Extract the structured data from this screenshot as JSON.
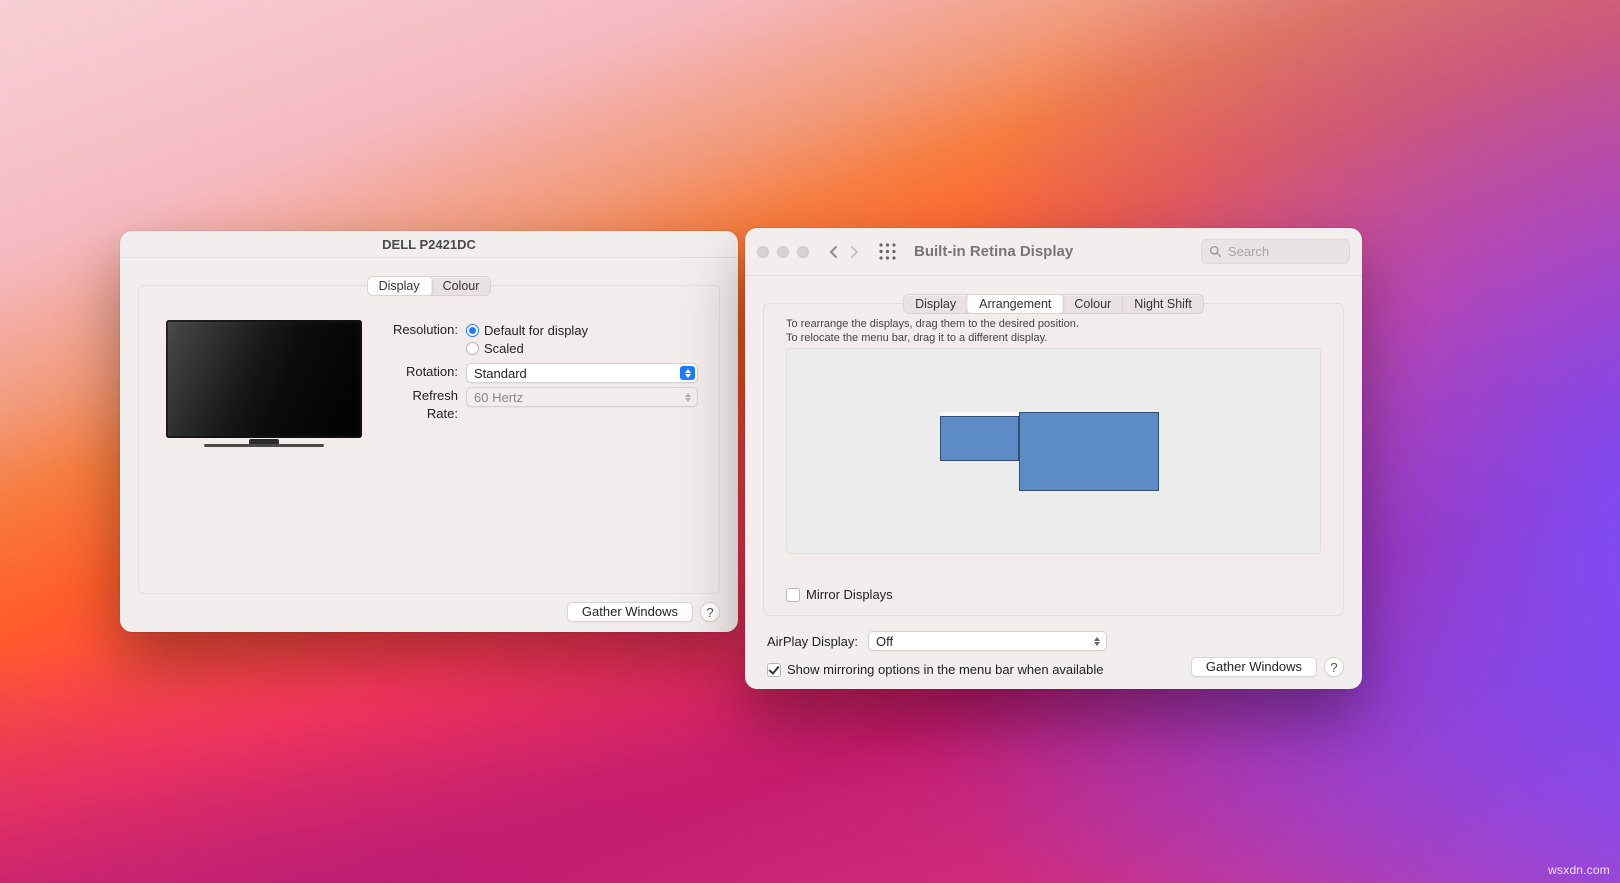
{
  "watermark": "wsxdn.com",
  "win1": {
    "title": "DELL P2421DC",
    "tabs": {
      "display": "Display",
      "colour": "Colour",
      "active": "display"
    },
    "labels": {
      "resolution": "Resolution:",
      "rotation": "Rotation:",
      "refresh": "Refresh Rate:"
    },
    "resolution": {
      "default": "Default for display",
      "scaled": "Scaled",
      "selected": "default"
    },
    "rotation_value": "Standard",
    "refresh_value": "60 Hertz",
    "gather_button": "Gather Windows",
    "help": "?"
  },
  "win2": {
    "title": "Built-in Retina Display",
    "search_placeholder": "Search",
    "tabs": {
      "display": "Display",
      "arrangement": "Arrangement",
      "colour": "Colour",
      "nightshift": "Night Shift",
      "active": "arrangement"
    },
    "hint_line1": "To rearrange the displays, drag them to the desired position.",
    "hint_line2": "To relocate the menu bar, drag it to a different display.",
    "mirror_label": "Mirror Displays",
    "mirror_checked": false,
    "airplay_label": "AirPlay Display:",
    "airplay_value": "Off",
    "show_mirroring_label": "Show mirroring options in the menu bar when available",
    "show_mirroring_checked": true,
    "gather_button": "Gather Windows",
    "help": "?"
  }
}
